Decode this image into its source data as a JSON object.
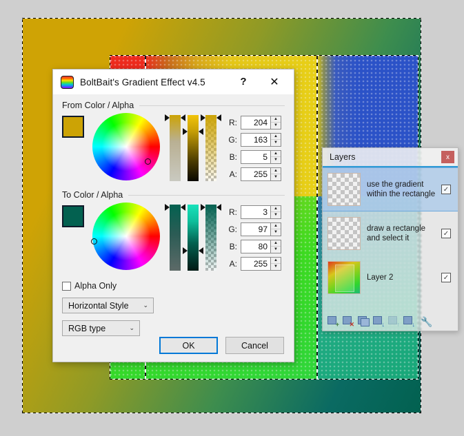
{
  "app": {
    "canvas_description": "Paint.NET image canvas with gradient layer and rectangular selection"
  },
  "dialog": {
    "title": "BoltBait's Gradient Effect v4.5",
    "icon": "gradient-rainbow-icon",
    "help_label": "?",
    "close_label": "✕",
    "from_section_label": "From Color / Alpha",
    "to_section_label": "To Color / Alpha",
    "from_color": {
      "hex": "#cca305",
      "channels": [
        {
          "label": "R:",
          "value": "204"
        },
        {
          "label": "G:",
          "value": "163"
        },
        {
          "label": "B:",
          "value": "5"
        },
        {
          "label": "A:",
          "value": "255"
        }
      ]
    },
    "to_color": {
      "hex": "#036150",
      "channels": [
        {
          "label": "R:",
          "value": "3"
        },
        {
          "label": "G:",
          "value": "97"
        },
        {
          "label": "B:",
          "value": "80"
        },
        {
          "label": "A:",
          "value": "255"
        }
      ]
    },
    "alpha_only": {
      "label": "Alpha Only",
      "checked": false
    },
    "style_combo": {
      "value": "Horizontal Style",
      "chevron": "⌄"
    },
    "type_combo": {
      "value": "RGB type",
      "chevron": "⌄"
    },
    "ok_label": "OK",
    "cancel_label": "Cancel"
  },
  "layers": {
    "title": "Layers",
    "close_label": "x",
    "accent_color": "#2e9bd6",
    "items": [
      {
        "name": "use the gradient within the rectangle",
        "visible": "✓",
        "selected": true,
        "thumb": "checker"
      },
      {
        "name": "draw a rectangle and select it",
        "visible": "✓",
        "selected": false,
        "thumb": "checker"
      },
      {
        "name": "Layer 2",
        "visible": "✓",
        "selected": false,
        "thumb": "image"
      }
    ],
    "toolbar": [
      {
        "name": "add-new-layer",
        "mark": "+",
        "mark_color": "#3f7a3f",
        "disabled": false
      },
      {
        "name": "delete-layer",
        "mark": "✕",
        "mark_color": "#c0392b",
        "disabled": false
      },
      {
        "name": "duplicate-layer",
        "mark": "",
        "mark_color": "",
        "disabled": false
      },
      {
        "name": "merge-layer-down",
        "mark": "↓",
        "mark_color": "#2e6fb0",
        "disabled": false
      },
      {
        "name": "move-layer-up",
        "mark": "↑",
        "mark_color": "#2e6fb0",
        "disabled": true
      },
      {
        "name": "move-layer-down",
        "mark": "↓",
        "mark_color": "#2e6fb0",
        "disabled": false
      },
      {
        "name": "layer-properties",
        "mark": "🔧",
        "mark_color": "#3f72ab",
        "disabled": false
      }
    ],
    "properties_icon": "🔧"
  },
  "spinner": {
    "up": "▲",
    "down": "▼"
  }
}
